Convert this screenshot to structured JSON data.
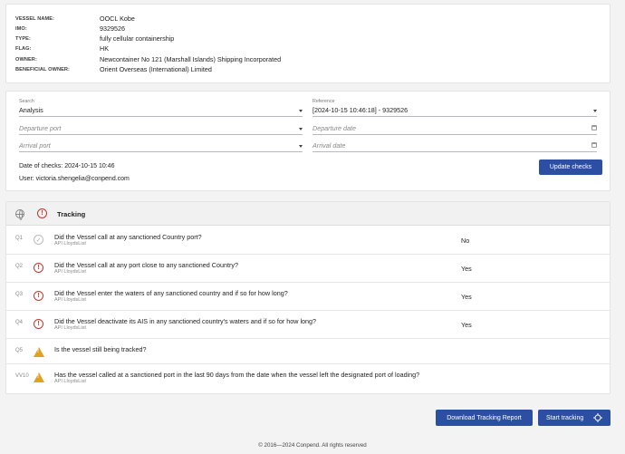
{
  "vessel": {
    "rows": [
      {
        "label": "VESSEL NAME:",
        "value": "OOCL Kobe"
      },
      {
        "label": "IMO:",
        "value": "9329526"
      },
      {
        "label": "TYPE:",
        "value": "fully cellular containership"
      },
      {
        "label": "FLAG:",
        "value": "HK"
      },
      {
        "label": "OWNER:",
        "value": "Newcontainer No 121 (Marshall Islands) Shipping Incorporated"
      },
      {
        "label": "BENEFICIAL OWNER:",
        "value": "Orient Overseas (International) Limited"
      }
    ]
  },
  "form": {
    "search_label": "Search",
    "search_value": "Analysis",
    "reference_label": "Reference",
    "reference_value": "[2024-10-15 10:46:18] - 9329526",
    "departure_port_placeholder": "Departure port",
    "departure_date_placeholder": "Departure date",
    "arrival_port_placeholder": "Arrival port",
    "arrival_date_placeholder": "Arrival date",
    "date_of_checks": "Date of checks: 2024-10-15 10:46",
    "user": "User: victoria.shengelia@conpend.com",
    "update_button": "Update checks"
  },
  "tracking": {
    "title": "Tracking",
    "rows": [
      {
        "num": "Q1",
        "status": "ok",
        "question": "Did the Vessel call at any sanctioned Country port?",
        "source": "API LloydsList",
        "answer": "No"
      },
      {
        "num": "Q2",
        "status": "alert",
        "question": "Did the Vessel call at any port close to any sanctioned Country?",
        "source": "API LloydsList",
        "answer": "Yes"
      },
      {
        "num": "Q3",
        "status": "alert",
        "question": "Did the Vessel enter the waters of any sanctioned country and if so for how long?",
        "source": "API LloydsList",
        "answer": "Yes"
      },
      {
        "num": "Q4",
        "status": "alert",
        "question": "Did the Vessel deactivate its AIS in any sanctioned country's waters and if so for how long?",
        "source": "API LloydsList",
        "answer": "Yes"
      },
      {
        "num": "Q5",
        "status": "warn",
        "question": "Is the vessel still being tracked?",
        "source": "",
        "answer": ""
      },
      {
        "num": "VV10",
        "status": "warn",
        "question": "Has the vessel called at a sanctioned port in the last 90 days from the date when the vessel left the designated port of loading?",
        "source": "API LloydsList",
        "answer": ""
      }
    ]
  },
  "actions": {
    "download_report": "Download Tracking Report",
    "start_tracking": "Start tracking"
  },
  "footer": "© 2016—2024 Conpend. All rights reserved",
  "colors": {
    "accent": "#2d4fa3",
    "alert": "#c0392b",
    "warning": "#e0a020"
  }
}
